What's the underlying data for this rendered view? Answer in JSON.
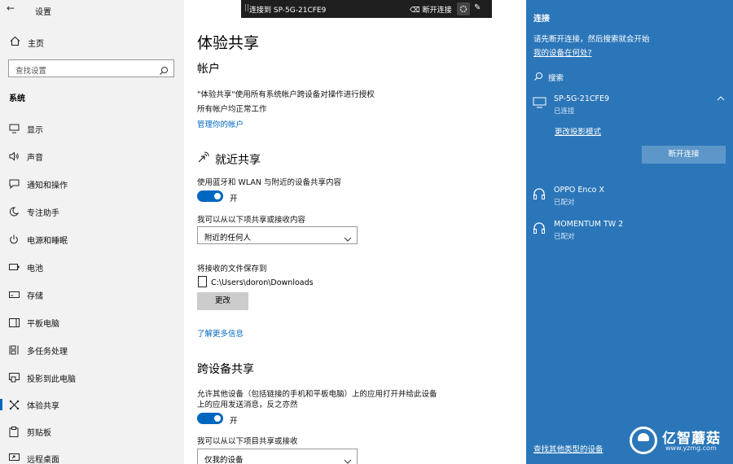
{
  "window": {
    "title": "设置"
  },
  "sidebar": {
    "home": "主页",
    "search_placeholder": "查找设置",
    "section": "系统",
    "items": [
      {
        "label": "显示",
        "icon": "monitor-icon"
      },
      {
        "label": "声音",
        "icon": "speaker-icon"
      },
      {
        "label": "通知和操作",
        "icon": "notification-icon"
      },
      {
        "label": "专注助手",
        "icon": "moon-icon"
      },
      {
        "label": "电源和睡眠",
        "icon": "power-icon"
      },
      {
        "label": "电池",
        "icon": "battery-icon"
      },
      {
        "label": "存储",
        "icon": "storage-icon"
      },
      {
        "label": "平板电脑",
        "icon": "tablet-icon"
      },
      {
        "label": "多任务处理",
        "icon": "multitask-icon"
      },
      {
        "label": "投影到此电脑",
        "icon": "project-icon"
      },
      {
        "label": "体验共享",
        "icon": "share-icon"
      },
      {
        "label": "剪贴板",
        "icon": "clipboard-icon"
      },
      {
        "label": "远程桌面",
        "icon": "remote-desktop-icon"
      }
    ],
    "active_index": 10
  },
  "connection_bar": {
    "text": "连接到 SP-5G-21CFE9",
    "disconnect": "断开连接"
  },
  "main": {
    "title": "体验共享",
    "account": {
      "heading": "帐户",
      "line1": "\"体验共享\"使用所有系统帐户跨设备对操作进行授权",
      "line2": "所有帐户均正常工作",
      "link": "管理你的帐户"
    },
    "nearby": {
      "heading": "就近共享",
      "desc": "使用蓝牙和 WLAN 与附近的设备共享内容",
      "toggle_label": "开",
      "share_with_label": "我可以从以下项共享或接收内容",
      "share_with_value": "附近的任何人",
      "save_label": "将接收的文件保存到",
      "save_path": "C:\\Users\\doron\\Downloads",
      "change_button": "更改",
      "learn_more": "了解更多信息"
    },
    "cross_device": {
      "heading": "跨设备共享",
      "desc_line1": "允许其他设备（包括链接的手机和平板电脑）上的应用打开并给此设备",
      "desc_line2": "上的应用发送消息，反之亦然",
      "toggle_label": "开",
      "share_with_label": "我可以从以下项目共享或接收",
      "share_with_value": "仅我的设备"
    }
  },
  "connect_panel": {
    "heading": "连接",
    "instruction": "请先断开连接，然后搜索就会开始",
    "where_link": "我的设备在何处?",
    "search_label": "搜索",
    "devices": [
      {
        "name": "SP-5G-21CFE9",
        "status": "已连接",
        "icon": "monitor-icon"
      },
      {
        "name": "OPPO Enco X",
        "status": "已配对",
        "icon": "headset-icon"
      },
      {
        "name": "MOMENTUM TW 2",
        "status": "已配对",
        "icon": "headset-icon"
      }
    ],
    "projection_mode": "更改投影模式",
    "disconnect_button": "断开连接",
    "other_devices": "查找其他类型的设备"
  },
  "watermark": {
    "brand": "亿智蘑菇",
    "url": "www.yzmg.com"
  },
  "colors": {
    "accent": "#0067c0",
    "panel": "#2b76b9",
    "sidebar": "#f2f2f2"
  }
}
